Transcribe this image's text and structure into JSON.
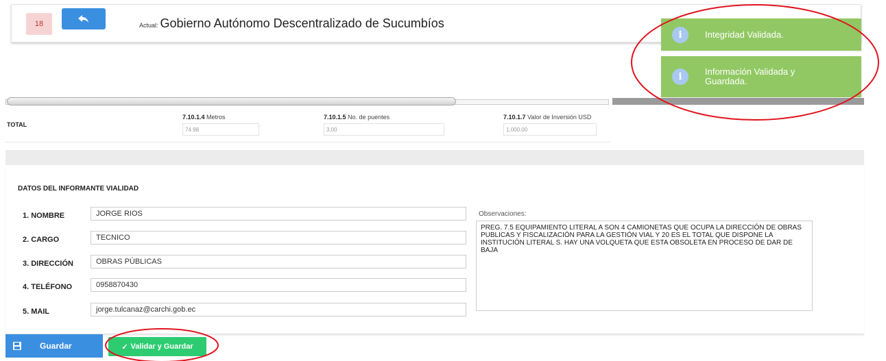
{
  "header": {
    "page_number": "18",
    "actual_label": "Actual:",
    "entity_name": "Gobierno Autónomo Descentralizado de Sucumbíos"
  },
  "totals": {
    "label": "TOTAL",
    "columns": [
      {
        "code": "7.10.1.4",
        "name": "Metros",
        "value": "74.98"
      },
      {
        "code": "7.10.1.5",
        "name": "No. de puentes",
        "value": "3.00"
      },
      {
        "code": "7.10.1.7",
        "name": "Valor de Inversión USD",
        "value": "1,000.00"
      }
    ]
  },
  "informante": {
    "title": "DATOS DEL INFORMANTE VIALIDAD",
    "fields": [
      {
        "label": "1. NOMBRE",
        "value": "JORGE RIOS"
      },
      {
        "label": "2. CARGO",
        "value": "TECNICO"
      },
      {
        "label": "3. DIRECCIÓN",
        "value": "OBRAS PÚBLICAS"
      },
      {
        "label": "4. TELÉFONO",
        "value": "0958870430"
      },
      {
        "label": "5. MAIL",
        "value": "jorge.tulcanaz@carchi.gob.ec"
      }
    ],
    "observaciones_label": "Observaciones:",
    "observaciones_text": "PREG. 7.5 EQUIPAMIENTO LITERAL A SON 4 CAMIONETAS QUE OCUPA LA DIRECCIÓN DE OBRAS PUBLICAS Y FISCALIZACIÓN PARA LA GESTIÓN VIAL Y 20 ES EL TOTAL QUE DISPONE LA INSTITUCIÓN LITERAL S. HAY UNA VOLQUETA QUE ESTA OBSOLETA EN PROCESO DE DAR DE BAJA"
  },
  "buttons": {
    "guardar": "Guardar",
    "validar": "Validar y Guardar"
  },
  "toasts": [
    {
      "text": "Integridad Validada."
    },
    {
      "text": "Información Validada y Guardada."
    }
  ],
  "colors": {
    "primary_blue": "#3b8fe0",
    "success_green": "#2ecc71",
    "toast_green": "#91c863",
    "annotation_red": "#e0141e"
  }
}
